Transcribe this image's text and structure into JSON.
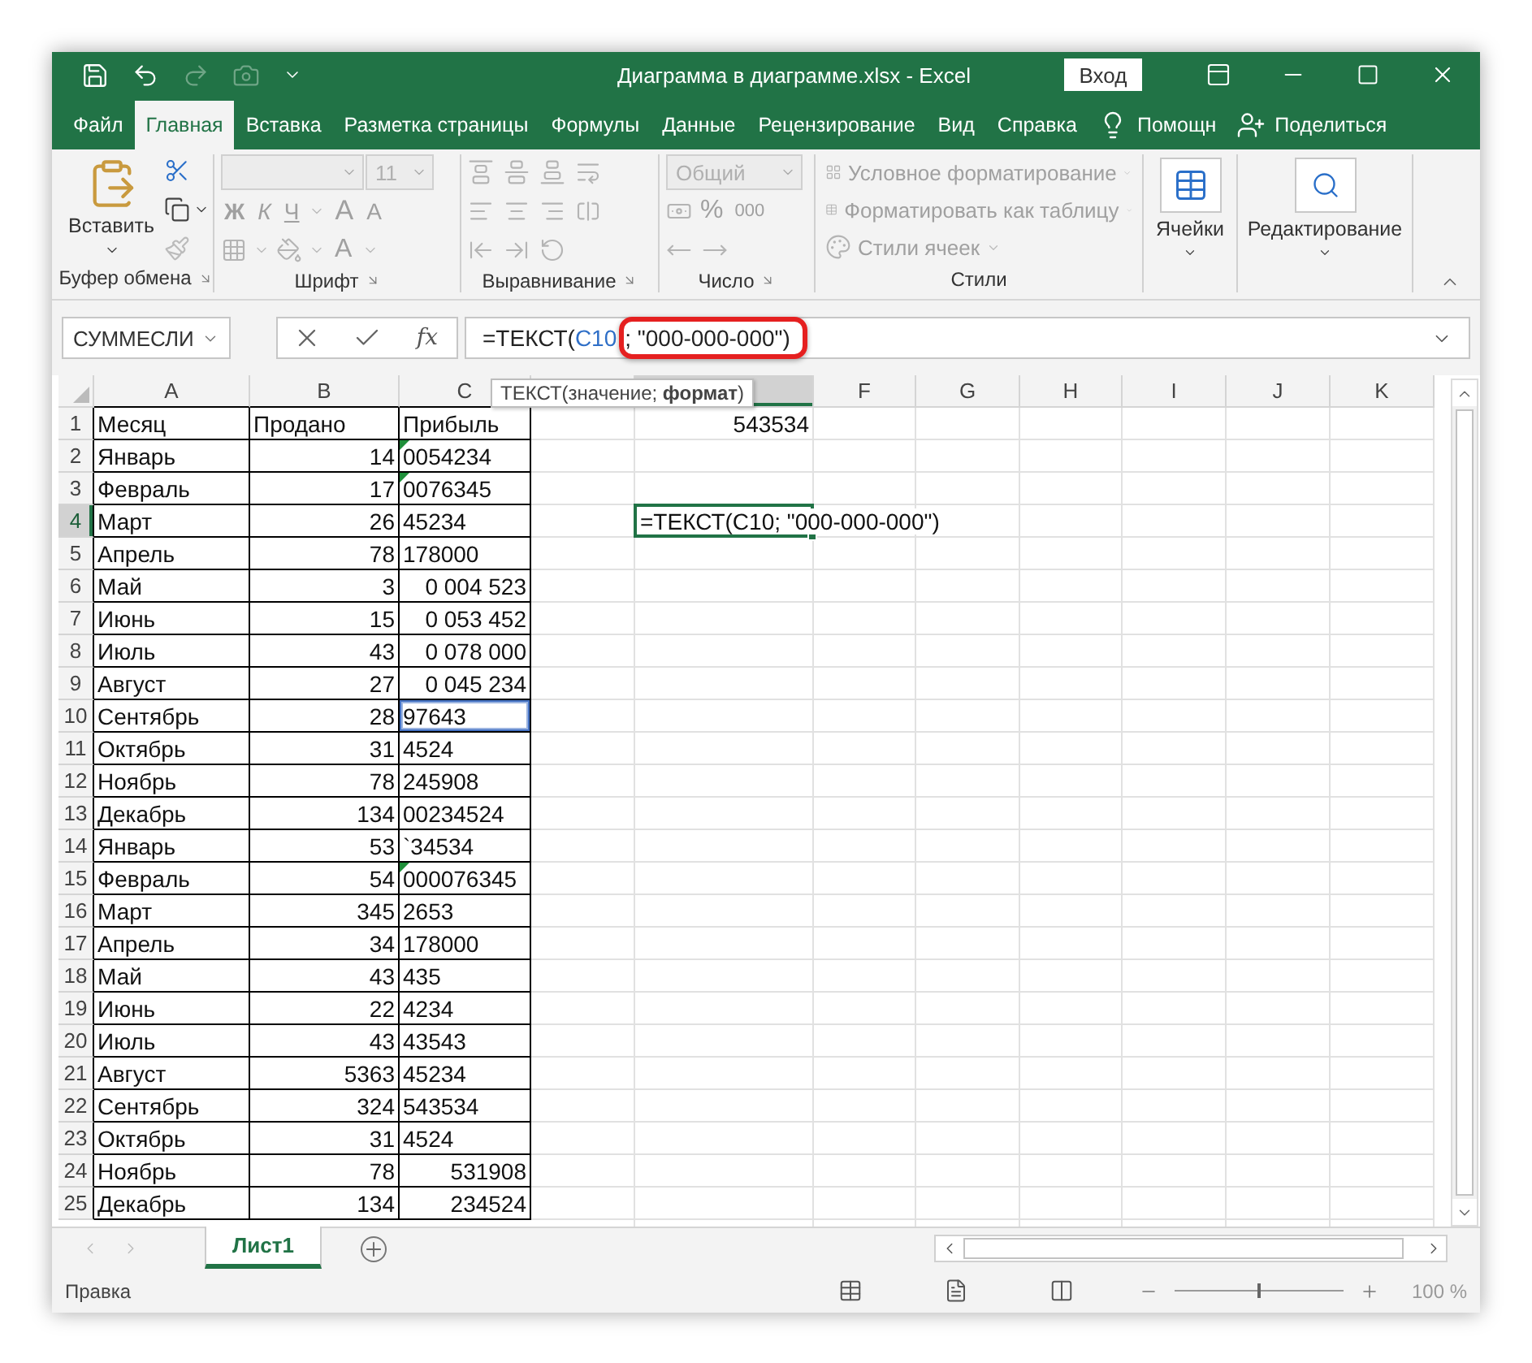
{
  "window": {
    "title": "Диаграмма в диаграмме.xlsx  -  Excel",
    "sign_in": "Вход"
  },
  "quick_access": [
    {
      "kind": "save",
      "disabled": false
    },
    {
      "kind": "undo",
      "disabled": false
    },
    {
      "kind": "redo",
      "disabled": true
    },
    {
      "kind": "camera",
      "disabled": true
    },
    {
      "kind": "customize",
      "disabled": false
    }
  ],
  "tabs": [
    {
      "label": "Файл",
      "selected": false
    },
    {
      "label": "Главная",
      "selected": true
    },
    {
      "label": "Вставка",
      "selected": false
    },
    {
      "label": "Разметка страницы",
      "selected": false
    },
    {
      "label": "Формулы",
      "selected": false
    },
    {
      "label": "Данные",
      "selected": false
    },
    {
      "label": "Рецензирование",
      "selected": false
    },
    {
      "label": "Вид",
      "selected": false
    },
    {
      "label": "Справка",
      "selected": false
    }
  ],
  "tell_me": "Помощн",
  "share": "Поделиться",
  "ribbon": {
    "clipboard": {
      "label": "Буфер обмена",
      "paste": "Вставить",
      "disabled": false
    },
    "font": {
      "label": "Шрифт",
      "size": "11",
      "styles": [
        "Ж",
        "К",
        "Ч"
      ],
      "grow": "A",
      "shrink": "A",
      "color_button": "A",
      "disabled": true
    },
    "alignment": {
      "label": "Выравнивание",
      "disabled": true
    },
    "number": {
      "label": "Число",
      "format": "Общий",
      "percent": "%",
      "thousands": "000",
      "disabled": true
    },
    "styles": {
      "label": "Стили",
      "disabled": true,
      "items": [
        {
          "label": "Условное форматирование",
          "kind": "conditional"
        },
        {
          "label": "Форматировать как таблицу",
          "kind": "table"
        },
        {
          "label": "Стили ячеек",
          "kind": "cell"
        }
      ]
    },
    "cells": {
      "label": "Ячейки",
      "disabled": false
    },
    "editing": {
      "label": "Редактирование",
      "disabled": false
    }
  },
  "formula_bar": {
    "name_box": "СУММЕСЛИ",
    "fx": "fx",
    "formula": [
      {
        "text": "=ТЕКСТ(",
        "ref": false,
        "highlighted": false
      },
      {
        "text": "C10",
        "ref": true,
        "highlighted": false
      },
      {
        "text": "; \"000-000-000\")",
        "ref": false,
        "highlighted": true
      }
    ]
  },
  "grid": {
    "tooltip": "ТЕКСТ(значение; **формат**)",
    "columns": [
      {
        "label": "A",
        "selected": false
      },
      {
        "label": "B",
        "selected": false
      },
      {
        "label": "C",
        "selected": false
      },
      {
        "selected": false
      },
      {
        "selected": true
      },
      {
        "label": "F",
        "selected": false
      },
      {
        "label": "G",
        "selected": false
      },
      {
        "label": "H",
        "selected": false
      },
      {
        "label": "I",
        "selected": false
      },
      {
        "label": "J",
        "selected": false
      },
      {
        "label": "K",
        "selected": false
      }
    ],
    "rows": [
      {
        "n": "1",
        "selected": false,
        "a": "Месяц",
        "b": "Продано",
        "b_right": false,
        "c": "Прибыль",
        "c_right": false,
        "c_flag": false,
        "c_ref": false,
        "e": {
          "text": "543534",
          "active": false
        }
      },
      {
        "n": "2",
        "selected": false,
        "a": "Январь",
        "b": "14",
        "b_right": true,
        "c": "0054234",
        "c_right": false,
        "c_flag": true,
        "c_ref": false
      },
      {
        "n": "3",
        "selected": false,
        "a": "Февраль",
        "b": "17",
        "b_right": true,
        "c": "0076345",
        "c_right": false,
        "c_flag": true,
        "c_ref": false
      },
      {
        "n": "4",
        "selected": true,
        "a": "Март",
        "b": "26",
        "b_right": true,
        "c": "45234",
        "c_right": false,
        "c_flag": false,
        "c_ref": false,
        "e": {
          "text": "=ТЕКСТ(C10; \"000-000-000\")",
          "active": true
        }
      },
      {
        "n": "5",
        "selected": false,
        "a": "Апрель",
        "b": "78",
        "b_right": true,
        "c": "178000",
        "c_right": false,
        "c_flag": false,
        "c_ref": false
      },
      {
        "n": "6",
        "selected": false,
        "a": "Май",
        "b": "3",
        "b_right": true,
        "c": "0 004 523",
        "c_right": true,
        "c_flag": false,
        "c_ref": false
      },
      {
        "n": "7",
        "selected": false,
        "a": "Июнь",
        "b": "15",
        "b_right": true,
        "c": "0 053 452",
        "c_right": true,
        "c_flag": false,
        "c_ref": false
      },
      {
        "n": "8",
        "selected": false,
        "a": "Июль",
        "b": "43",
        "b_right": true,
        "c": "0 078 000",
        "c_right": true,
        "c_flag": false,
        "c_ref": false
      },
      {
        "n": "9",
        "selected": false,
        "a": "Август",
        "b": "27",
        "b_right": true,
        "c": "0 045 234",
        "c_right": true,
        "c_flag": false,
        "c_ref": false
      },
      {
        "n": "10",
        "selected": false,
        "a": "Сентябрь",
        "b": "28",
        "b_right": true,
        "c": "97643",
        "c_right": false,
        "c_flag": false,
        "c_ref": true
      },
      {
        "n": "11",
        "selected": false,
        "a": "Октябрь",
        "b": "31",
        "b_right": true,
        "c": "4524",
        "c_right": false,
        "c_flag": false,
        "c_ref": false
      },
      {
        "n": "12",
        "selected": false,
        "a": "Ноябрь",
        "b": "78",
        "b_right": true,
        "c": "245908",
        "c_right": false,
        "c_flag": false,
        "c_ref": false
      },
      {
        "n": "13",
        "selected": false,
        "a": "Декабрь",
        "b": "134",
        "b_right": true,
        "c": "00234524",
        "c_right": false,
        "c_flag": false,
        "c_ref": false
      },
      {
        "n": "14",
        "selected": false,
        "a": "Январь",
        "b": "53",
        "b_right": true,
        "c": "`34534",
        "c_right": false,
        "c_flag": false,
        "c_ref": false
      },
      {
        "n": "15",
        "selected": false,
        "a": "Февраль",
        "b": "54",
        "b_right": true,
        "c": "000076345",
        "c_right": false,
        "c_flag": true,
        "c_ref": false
      },
      {
        "n": "16",
        "selected": false,
        "a": "Март",
        "b": "345",
        "b_right": true,
        "c": "2653",
        "c_right": false,
        "c_flag": false,
        "c_ref": false
      },
      {
        "n": "17",
        "selected": false,
        "a": "Апрель",
        "b": "34",
        "b_right": true,
        "c": "178000",
        "c_right": false,
        "c_flag": false,
        "c_ref": false
      },
      {
        "n": "18",
        "selected": false,
        "a": "Май",
        "b": "43",
        "b_right": true,
        "c": "435",
        "c_right": false,
        "c_flag": false,
        "c_ref": false
      },
      {
        "n": "19",
        "selected": false,
        "a": "Июнь",
        "b": "22",
        "b_right": true,
        "c": "4234",
        "c_right": false,
        "c_flag": false,
        "c_ref": false
      },
      {
        "n": "20",
        "selected": false,
        "a": "Июль",
        "b": "43",
        "b_right": true,
        "c": "43543",
        "c_right": false,
        "c_flag": false,
        "c_ref": false
      },
      {
        "n": "21",
        "selected": false,
        "a": "Август",
        "b": "5363",
        "b_right": true,
        "c": "45234",
        "c_right": false,
        "c_flag": false,
        "c_ref": false
      },
      {
        "n": "22",
        "selected": false,
        "a": "Сентябрь",
        "b": "324",
        "b_right": true,
        "c": "543534",
        "c_right": false,
        "c_flag": false,
        "c_ref": false
      },
      {
        "n": "23",
        "selected": false,
        "a": "Октябрь",
        "b": "31",
        "b_right": true,
        "c": "4524",
        "c_right": false,
        "c_flag": false,
        "c_ref": false
      },
      {
        "n": "24",
        "selected": false,
        "a": "Ноябрь",
        "b": "78",
        "b_right": true,
        "c": "531908",
        "c_right": true,
        "c_flag": false,
        "c_ref": false
      },
      {
        "n": "25",
        "selected": false,
        "a": "Декабрь",
        "b": "134",
        "b_right": true,
        "c": "234524",
        "c_right": true,
        "c_flag": false,
        "c_ref": false
      }
    ]
  },
  "sheets": [
    {
      "label": "Лист1",
      "selected": true
    }
  ],
  "status": {
    "mode": "Правка",
    "zoom": "100 %",
    "level": 0.5
  }
}
